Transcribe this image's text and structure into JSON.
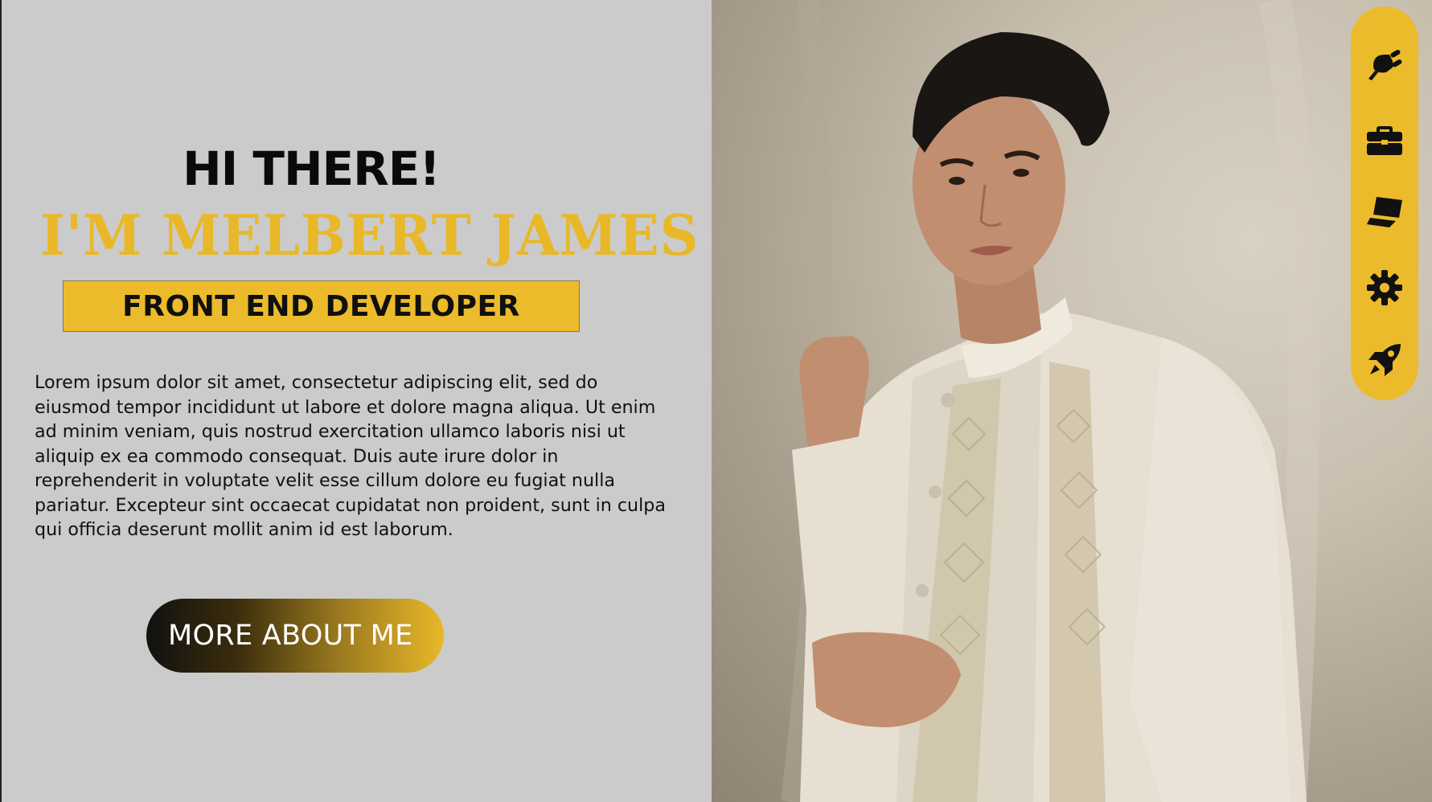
{
  "hero": {
    "greeting": "HI THERE!",
    "name": "I'M MELBERT JAMES",
    "role": "FRONT END DEVELOPER",
    "intro": "Lorem ipsum dolor sit amet, consectetur adipiscing elit, sed do eiusmod tempor incididunt ut labore et dolore magna aliqua. Ut enim ad minim veniam, quis nostrud exercitation ullamco laboris nisi ut aliquip ex ea commodo consequat. Duis aute irure dolor in reprehenderit in voluptate velit esse cillum dolore eu fugiat nulla pariatur. Excepteur sint occaecat cupidatat non proident, sunt in culpa qui officia deserunt mollit anim id est laborum.",
    "cta_label": "MORE ABOUT ME"
  },
  "side_nav": {
    "items": [
      {
        "icon": "plug-icon"
      },
      {
        "icon": "briefcase-icon"
      },
      {
        "icon": "laptop-icon"
      },
      {
        "icon": "gear-icon"
      },
      {
        "icon": "rocket-icon"
      }
    ]
  },
  "colors": {
    "accent": "#ebbb2b",
    "background": "#cbcbcb",
    "text": "#111111"
  }
}
